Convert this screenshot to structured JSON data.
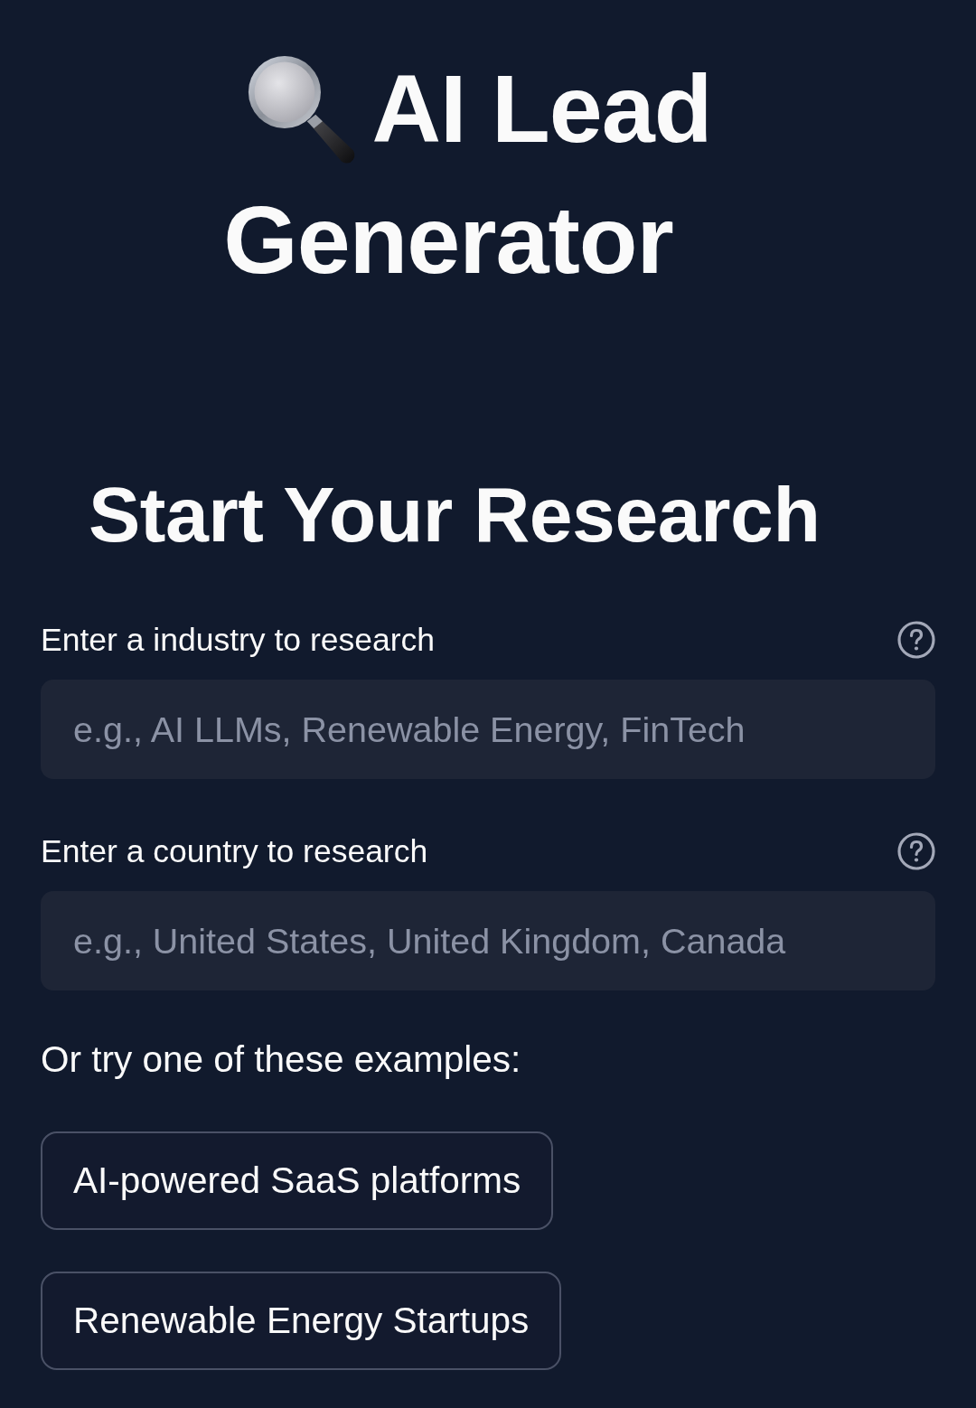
{
  "header": {
    "title_lines": [
      "AI Lead",
      "Generator"
    ]
  },
  "section": {
    "heading": "Start Your Research"
  },
  "fields": [
    {
      "label": "Enter a industry to research",
      "placeholder": "e.g., AI LLMs, Renewable Energy, FinTech"
    },
    {
      "label": "Enter a country to research",
      "placeholder": "e.g., United States, United Kingdom, Canada"
    }
  ],
  "examples": {
    "prompt": "Or try one of these examples:",
    "buttons": [
      "AI-powered SaaS platforms",
      "Renewable Energy Startups"
    ]
  }
}
